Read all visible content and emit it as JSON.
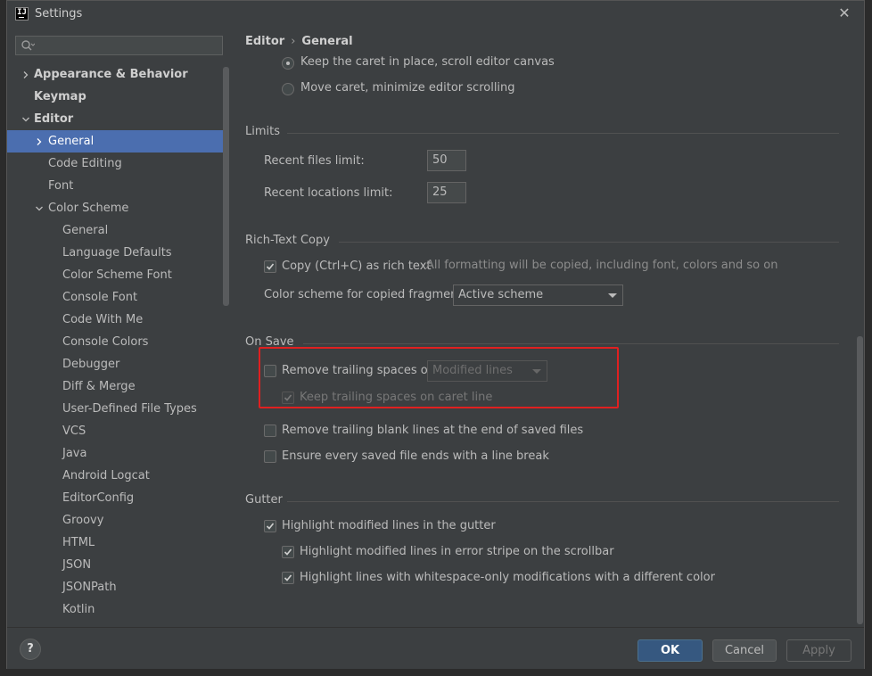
{
  "window": {
    "title": "Settings"
  },
  "search": {
    "placeholder": ""
  },
  "sidebar": {
    "items": [
      {
        "label": "Appearance & Behavior",
        "level": 0,
        "chevron": "right",
        "bold": true
      },
      {
        "label": "Keymap",
        "level": 0,
        "chevron": "",
        "bold": true
      },
      {
        "label": "Editor",
        "level": 0,
        "chevron": "down",
        "bold": true
      },
      {
        "label": "General",
        "level": 1,
        "chevron": "right",
        "selected": true
      },
      {
        "label": "Code Editing",
        "level": 1
      },
      {
        "label": "Font",
        "level": 1
      },
      {
        "label": "Color Scheme",
        "level": 1,
        "chevron": "down"
      },
      {
        "label": "General",
        "level": 2
      },
      {
        "label": "Language Defaults",
        "level": 2
      },
      {
        "label": "Color Scheme Font",
        "level": 2
      },
      {
        "label": "Console Font",
        "level": 2
      },
      {
        "label": "Code With Me",
        "level": 2
      },
      {
        "label": "Console Colors",
        "level": 2
      },
      {
        "label": "Debugger",
        "level": 2
      },
      {
        "label": "Diff & Merge",
        "level": 2
      },
      {
        "label": "User-Defined File Types",
        "level": 2
      },
      {
        "label": "VCS",
        "level": 2
      },
      {
        "label": "Java",
        "level": 2
      },
      {
        "label": "Android Logcat",
        "level": 2
      },
      {
        "label": "EditorConfig",
        "level": 2
      },
      {
        "label": "Groovy",
        "level": 2
      },
      {
        "label": "HTML",
        "level": 2
      },
      {
        "label": "JSON",
        "level": 2
      },
      {
        "label": "JSONPath",
        "level": 2
      },
      {
        "label": "Kotlin",
        "level": 2
      }
    ]
  },
  "breadcrumb": {
    "parent": "Editor",
    "current": "General"
  },
  "scrolling": {
    "option1": "Keep the caret in place, scroll editor canvas",
    "option2": "Move caret, minimize editor scrolling"
  },
  "limits": {
    "title": "Limits",
    "recent_files_label": "Recent files limit:",
    "recent_files_value": "50",
    "recent_locations_label": "Recent locations limit:",
    "recent_locations_value": "25"
  },
  "rich_text": {
    "title": "Rich-Text Copy",
    "copy_label": "Copy (Ctrl+C) as rich text",
    "copy_hint": "All formatting will be copied, including font, colors and so on",
    "scheme_label": "Color scheme for copied fragment:",
    "scheme_value": "Active scheme"
  },
  "on_save": {
    "title": "On Save",
    "remove_trailing_label": "Remove trailing spaces on:",
    "remove_trailing_value": "Modified lines",
    "keep_trailing_label": "Keep trailing spaces on caret line",
    "remove_blank_label": "Remove trailing blank lines at the end of saved files",
    "ensure_break_label": "Ensure every saved file ends with a line break"
  },
  "gutter": {
    "title": "Gutter",
    "highlight_modified": "Highlight modified lines in the gutter",
    "highlight_error_stripe": "Highlight modified lines in error stripe on the scrollbar",
    "highlight_whitespace": "Highlight lines with whitespace-only modifications with a different color"
  },
  "footer": {
    "help": "?",
    "ok": "OK",
    "cancel": "Cancel",
    "apply": "Apply"
  },
  "colors": {
    "selection": "#4b6eaf",
    "ok_button": "#365880",
    "highlight_box": "#e02020",
    "background": "#3c3f41"
  }
}
